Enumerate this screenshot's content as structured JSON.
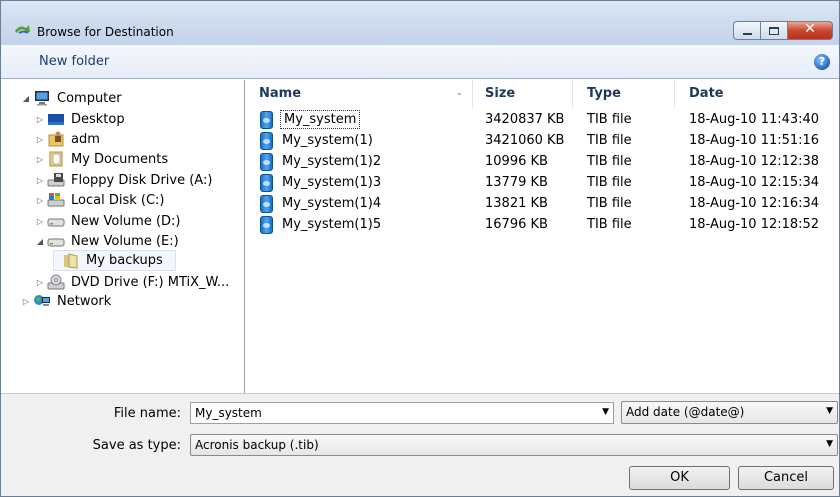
{
  "window": {
    "title": "Browse for Destination",
    "close_glyph": "✕"
  },
  "toolbar": {
    "new_folder": "New folder",
    "help_glyph": "?"
  },
  "tree": {
    "items": [
      {
        "label": "Computer",
        "icon": "computer-icon"
      },
      {
        "label": "Desktop",
        "icon": "desktop-icon"
      },
      {
        "label": "adm",
        "icon": "user-folder-icon"
      },
      {
        "label": "My Documents",
        "icon": "documents-icon"
      },
      {
        "label": "Floppy Disk Drive (A:)",
        "icon": "floppy-drive-icon"
      },
      {
        "label": "Local Disk (C:)",
        "icon": "system-drive-icon"
      },
      {
        "label": "New Volume (D:)",
        "icon": "drive-icon"
      },
      {
        "label": "New Volume (E:)",
        "icon": "drive-icon"
      },
      {
        "label": "My backups",
        "icon": "folder-icon"
      },
      {
        "label": "DVD Drive (F:) MTiX_W...",
        "icon": "dvd-drive-icon"
      },
      {
        "label": "Network",
        "icon": "network-icon"
      }
    ]
  },
  "list": {
    "columns": [
      "Name",
      "Size",
      "Type",
      "Date"
    ],
    "rows": [
      {
        "name": "My_system",
        "size": "3420837 KB",
        "type": "TIB file",
        "date": "18-Aug-10 11:43:40"
      },
      {
        "name": "My_system(1)",
        "size": "3421060 KB",
        "type": "TIB file",
        "date": "18-Aug-10 11:51:16"
      },
      {
        "name": "My_system(1)2",
        "size": "10996 KB",
        "type": "TIB file",
        "date": "18-Aug-10 12:12:38"
      },
      {
        "name": "My_system(1)3",
        "size": "13779 KB",
        "type": "TIB file",
        "date": "18-Aug-10 12:15:34"
      },
      {
        "name": "My_system(1)4",
        "size": "13821 KB",
        "type": "TIB file",
        "date": "18-Aug-10 12:16:34"
      },
      {
        "name": "My_system(1)5",
        "size": "16796 KB",
        "type": "TIB file",
        "date": "18-Aug-10 12:18:52"
      }
    ]
  },
  "form": {
    "file_name_label": "File name:",
    "file_name_value": "My_system",
    "date_option": "Add date (@date@)",
    "save_type_label": "Save as type:",
    "save_type_value": "Acronis backup (.tib)",
    "ok_label": "OK",
    "cancel_label": "Cancel"
  },
  "colors": {
    "accent": "#1e3c78",
    "titlebar": "#cfdcee",
    "close": "#c9472f"
  }
}
